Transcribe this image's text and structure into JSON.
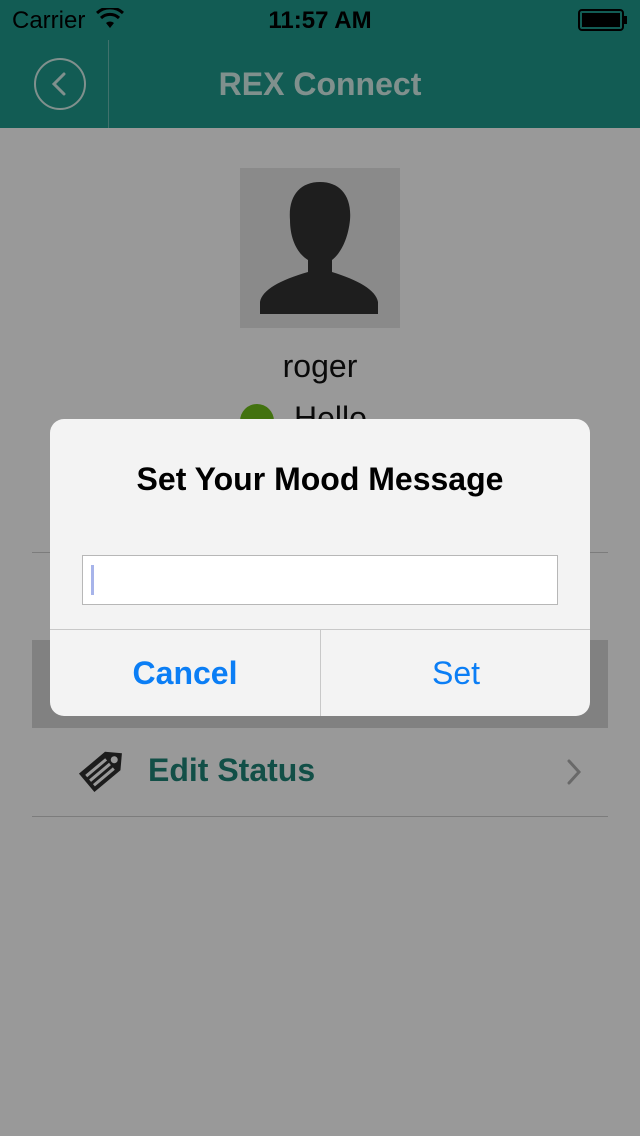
{
  "status_bar": {
    "carrier": "Carrier",
    "time": "11:57 AM",
    "icons": [
      "wifi-icon",
      "battery-icon"
    ]
  },
  "nav": {
    "title": "REX Connect",
    "back_icon": "chevron-left-icon",
    "color": "#1e9a8c"
  },
  "profile": {
    "avatar_icon": "person-silhouette-icon",
    "username": "roger",
    "mood": "Hello",
    "status_color": "#6fbf1a"
  },
  "menu": {
    "items": [
      {
        "icon": "tag-icon",
        "label": "Edit Status",
        "accessory": "chevron-right-icon"
      }
    ]
  },
  "alert": {
    "title": "Set Your Mood Message",
    "input_value": "",
    "cancel_label": "Cancel",
    "set_label": "Set",
    "button_color": "#0b7ef5"
  }
}
